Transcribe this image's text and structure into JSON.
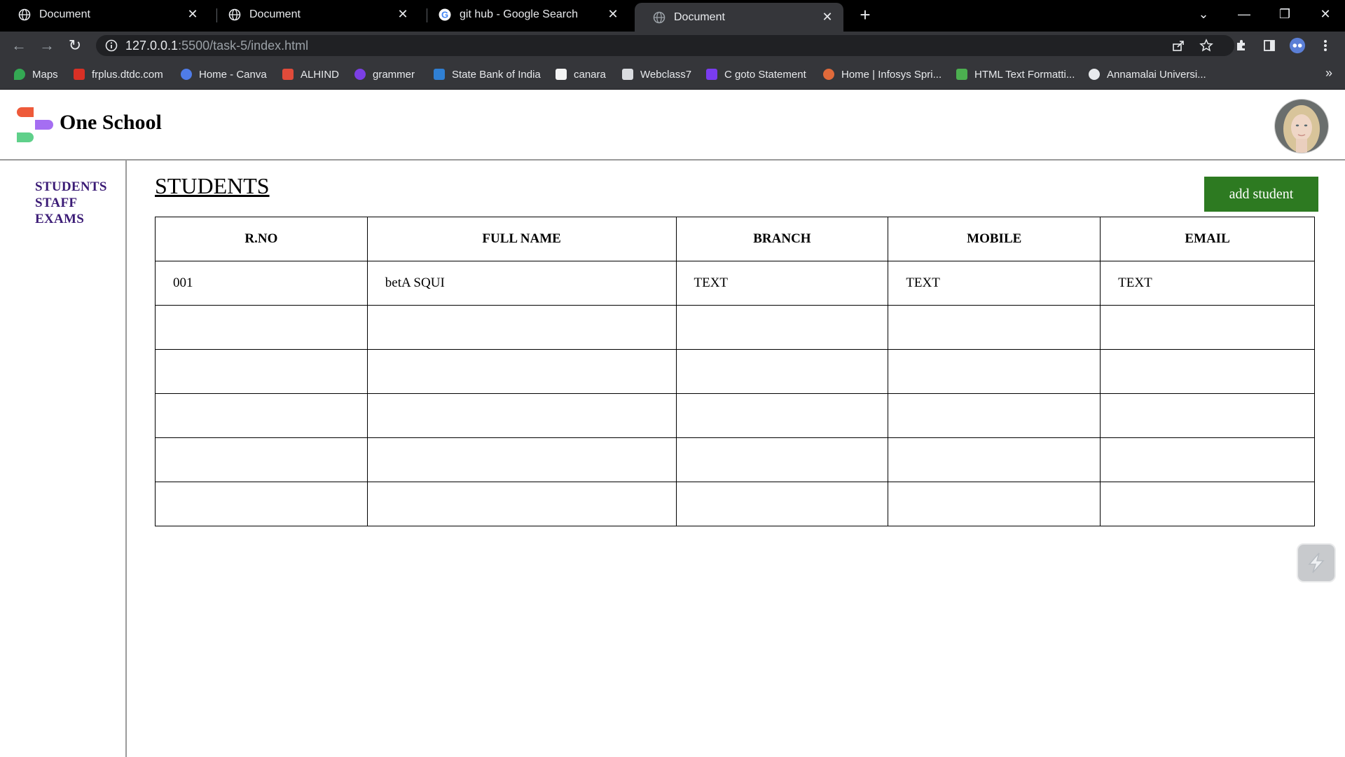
{
  "browser": {
    "tabs": [
      {
        "label": "Document",
        "icon": "globe-icon",
        "active": false
      },
      {
        "label": "Document",
        "icon": "globe-icon",
        "active": false
      },
      {
        "label": "git hub - Google Search",
        "icon": "google-icon",
        "active": false
      },
      {
        "label": "Document",
        "icon": "globe-icon",
        "active": true
      }
    ],
    "url_host": "127.0.0.1",
    "url_path": ":5500/task-5/index.html",
    "bookmarks": [
      {
        "label": "Maps",
        "color": "#34a853"
      },
      {
        "label": "frplus.dtdc.com",
        "color": "#d93025"
      },
      {
        "label": "Home - Canva",
        "color": "#4f7ce8"
      },
      {
        "label": "ALHIND",
        "color": "#e04b3a"
      },
      {
        "label": "grammer",
        "color": "#7b3fe4"
      },
      {
        "label": "State Bank of India",
        "color": "#2f7fd3"
      },
      {
        "label": "canara",
        "color": "#f4f4f4"
      },
      {
        "label": "Webclass7",
        "color": "#dadce0"
      },
      {
        "label": "C goto Statement",
        "color": "#7a3cf0"
      },
      {
        "label": "Home | Infosys Spri...",
        "color": "#e06a3a"
      },
      {
        "label": "HTML Text Formatti...",
        "color": "#4caf50"
      },
      {
        "label": "Annamalai Universi...",
        "color": "#e8eaed"
      }
    ],
    "more": "»"
  },
  "app": {
    "brand": "One School",
    "nav": [
      "STUDENTS",
      "STAFF",
      "EXAMS"
    ],
    "page_title": "STUDENTS",
    "add_button": "add student",
    "table": {
      "headers": [
        "R.NO",
        "FULL NAME",
        "BRANCH",
        "MOBILE",
        "EMAIL"
      ],
      "rows": [
        [
          "001",
          "betA SQUI",
          "TEXT",
          "TEXT",
          "TEXT"
        ],
        [
          "",
          "",
          "",
          "",
          ""
        ],
        [
          "",
          "",
          "",
          "",
          ""
        ],
        [
          "",
          "",
          "",
          "",
          ""
        ],
        [
          "",
          "",
          "",
          "",
          ""
        ],
        [
          "",
          "",
          "",
          "",
          ""
        ]
      ]
    }
  },
  "colors": {
    "tabbar": "#000000",
    "toolbar": "#35363a",
    "add_button": "#2d7a21",
    "nav_link": "#3b1b76"
  }
}
